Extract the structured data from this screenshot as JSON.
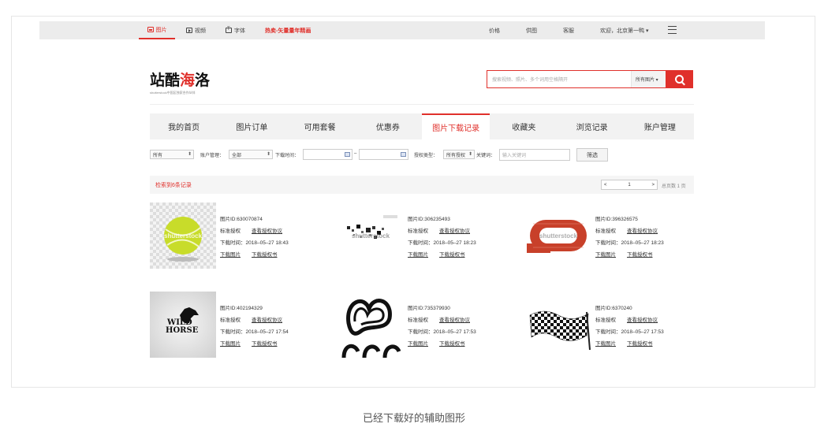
{
  "topbar": {
    "tabs": [
      {
        "label": "图片",
        "icon": "image-icon",
        "active": true
      },
      {
        "label": "视频",
        "icon": "video-icon",
        "active": false
      },
      {
        "label": "字体",
        "icon": "font-icon",
        "active": false
      }
    ],
    "promo": "热卖-矢量量年精画",
    "right": [
      "价格",
      "供图",
      "客服",
      "欢迎，北京第一鸭 ▾"
    ],
    "menu_icon": "hamburger-menu-icon"
  },
  "logo": {
    "main_a": "站酷",
    "main_b": "海",
    "main_c": "洛",
    "sub": "shutterstock中国区独家合作伙伴"
  },
  "search": {
    "placeholder": "搜索视频、照片、多个词用空格隔开",
    "category": "所有图片 ▾",
    "button_icon": "search-icon"
  },
  "nav": {
    "items": [
      "我的首页",
      "图片订单",
      "可用套餐",
      "优惠券",
      "图片下载记录",
      "收藏夹",
      "浏览记录",
      "账户管理"
    ],
    "active_index": 4
  },
  "filters": {
    "type_select": "所有",
    "account_label": "账户管理：",
    "account_select": "全部",
    "time_label": "下载时间：",
    "date_sep": "–",
    "license_label": "授权类型：",
    "license_select": "所有授权",
    "keyword_label": "关键词：",
    "keyword_placeholder": "输入关键词",
    "filter_button": "筛选"
  },
  "results": {
    "count_text": "检索到6条记录",
    "pager_prev": "<",
    "pager_page": "1",
    "pager_next": ">",
    "total_pages": "总页数 1 页"
  },
  "records": [
    {
      "id": "图片ID:630070874",
      "license": "标准授权",
      "agreement": "查看授权协议",
      "time": "下载时间：2018–05–27 18:43",
      "download": "下载图片",
      "cert": "下载授权书"
    },
    {
      "id": "图片ID:306235493",
      "license": "标准授权",
      "agreement": "查看授权协议",
      "time": "下载时间：2018–05–27 18:23",
      "download": "下载图片",
      "cert": "下载授权书"
    },
    {
      "id": "图片ID:396326575",
      "license": "标准授权",
      "agreement": "查看授权协议",
      "time": "下载时间：2018–05–27 18:23",
      "download": "下载图片",
      "cert": "下载授权书"
    },
    {
      "id": "图片ID:402194329",
      "license": "标准授权",
      "agreement": "查看授权协议",
      "time": "下载时间：2018–05–27 17:54",
      "download": "下载图片",
      "cert": "下载授权书"
    },
    {
      "id": "图片ID:735379930",
      "license": "标准授权",
      "agreement": "查看授权协议",
      "time": "下载时间：2018–05–27 17:53",
      "download": "下载图片",
      "cert": "下载授权书"
    },
    {
      "id": "图片ID:6370240",
      "license": "标准授权",
      "agreement": "查看授权协议",
      "time": "下载时间：2018–05–27 17:53",
      "download": "下载图片",
      "cert": "下载授权书"
    }
  ],
  "thumb_texts": {
    "watermark": "shutterstock",
    "horse_a": "WILD",
    "horse_b": "HORSE"
  },
  "caption": "已经下载好的辅助图形",
  "colors": {
    "accent": "#e0302b"
  }
}
